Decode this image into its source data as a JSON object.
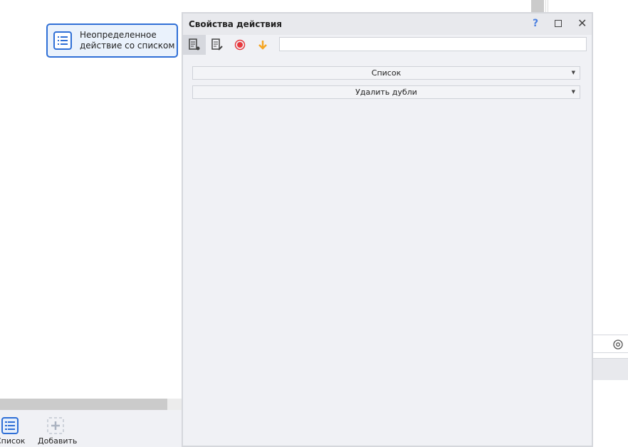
{
  "canvas": {
    "node_label": "Неопределенное действие со списком"
  },
  "bottom_toolbar": {
    "list_label": "Список",
    "add_label": "Добавить"
  },
  "panel": {
    "title": "Свойства действия",
    "help": "?",
    "filter_value": "",
    "fields": [
      {
        "value": "Список"
      },
      {
        "value": "Удалить дубли"
      }
    ]
  },
  "colors": {
    "accent": "#2f6fd6",
    "record": "#e8383d",
    "arrow": "#f5a623"
  }
}
